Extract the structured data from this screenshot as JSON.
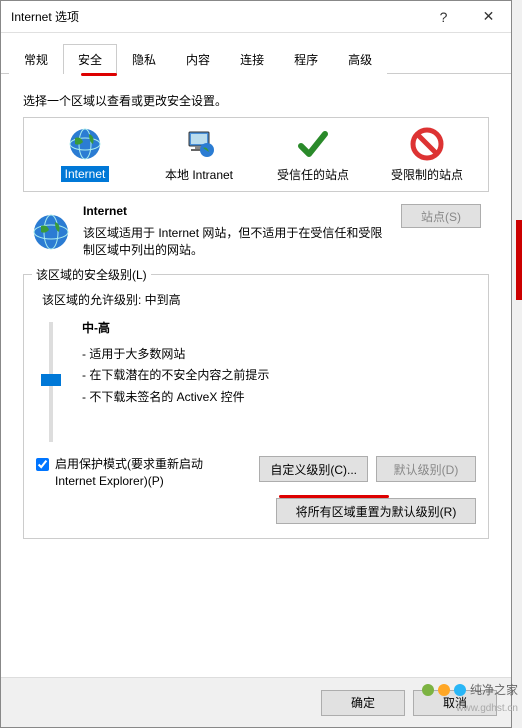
{
  "titlebar": {
    "title": "Internet 选项"
  },
  "tabs": [
    "常规",
    "安全",
    "隐私",
    "内容",
    "连接",
    "程序",
    "高级"
  ],
  "active_tab_index": 1,
  "instruction": "选择一个区域以查看或更改安全设置。",
  "zones": [
    {
      "label": "Internet",
      "selected": true
    },
    {
      "label": "本地 Intranet",
      "selected": false
    },
    {
      "label": "受信任的站点",
      "selected": false
    },
    {
      "label": "受限制的站点",
      "selected": false
    }
  ],
  "zone_detail": {
    "title": "Internet",
    "desc": "该区域适用于 Internet 网站，但不适用于在受信任和受限制区域中列出的网站。",
    "sites_btn": "站点(S)"
  },
  "security_level": {
    "legend": "该区域的安全级别(L)",
    "allowed_note": "该区域的允许级别: 中到高",
    "level_name": "中-高",
    "bullets": [
      "- 适用于大多数网站",
      "- 在下载潜在的不安全内容之前提示",
      "- 不下载未签名的 ActiveX 控件"
    ]
  },
  "protected_mode": {
    "checked": true,
    "label": "启用保护模式(要求重新启动 Internet Explorer)(P)"
  },
  "buttons": {
    "custom_level": "自定义级别(C)...",
    "default_level": "默认级别(D)",
    "reset_all": "将所有区域重置为默认级别(R)"
  },
  "footer": {
    "ok": "确定",
    "cancel": "取消"
  },
  "watermark": {
    "text": "纯净之家",
    "url": "www.gdhst.cn"
  }
}
